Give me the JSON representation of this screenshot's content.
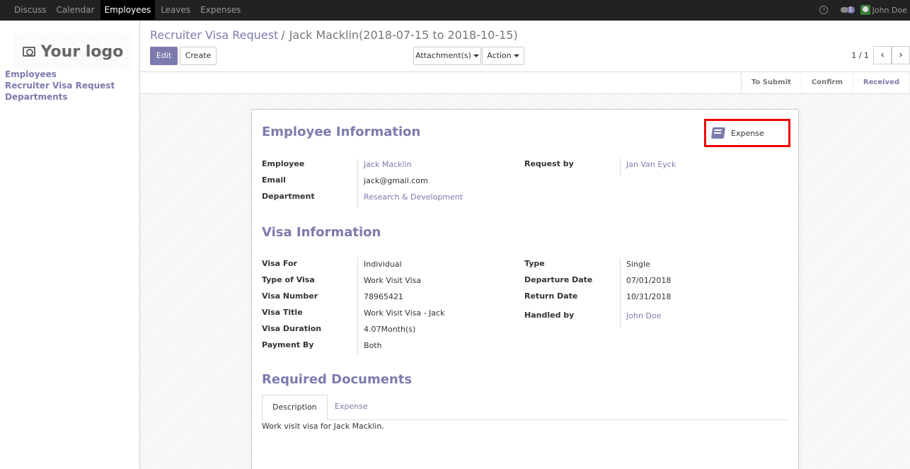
{
  "topbar": {
    "menu": [
      "Discuss",
      "Calendar",
      "Employees",
      "Leaves",
      "Expenses"
    ],
    "active_index": 2,
    "chat_count": "1",
    "user_name": "John Doe"
  },
  "sidebar": {
    "logo_text": "Your logo",
    "links": [
      "Employees",
      "Recruiter Visa Request",
      "Departments"
    ]
  },
  "control": {
    "breadcrumb_parent": "Recruiter Visa Request",
    "breadcrumb_sep": "/",
    "breadcrumb_current": "Jack Macklin(2018-07-15 to 2018-10-15)",
    "edit_label": "Edit",
    "create_label": "Create",
    "attachments_label": "Attachment(s)",
    "action_label": "Action",
    "pager_value": "1 / 1",
    "pager_prev": "‹",
    "pager_next": "›"
  },
  "statusbar": {
    "stages": [
      "To Submit",
      "Confirm",
      "Received"
    ],
    "current_index": 2
  },
  "sheet": {
    "smart_button_label": "Expense",
    "employee_info": {
      "title": "Employee Information",
      "employee_label": "Employee",
      "employee_value": "Jack Macklin",
      "email_label": "Email",
      "email_value": "jack@gmail.com",
      "department_label": "Department",
      "department_value": "Research & Development",
      "request_by_label": "Request by",
      "request_by_value": "Jan Van Eyck"
    },
    "visa_info": {
      "title": "Visa Information",
      "visa_for_label": "Visa For",
      "visa_for_value": "Individual",
      "type_of_visa_label": "Type of Visa",
      "type_of_visa_value": "Work Visit Visa",
      "visa_number_label": "Visa Number",
      "visa_number_value": "78965421",
      "visa_title_label": "Visa Title",
      "visa_title_value": "Work Visit Visa - Jack",
      "visa_duration_label": "Visa Duration",
      "visa_duration_value": "4.07Month(s)",
      "payment_by_label": "Payment By",
      "payment_by_value": "Both",
      "type_label": "Type",
      "type_value": "Single",
      "departure_label": "Departure Date",
      "departure_value": "07/01/2018",
      "return_label": "Return Date",
      "return_value": "10/31/2018",
      "handled_by_label": "Handled by",
      "handled_by_value": "John Doe"
    },
    "required_docs": {
      "title": "Required Documents",
      "tabs": [
        "Description",
        "Expense"
      ],
      "description_text": "Work visit visa for Jack Macklin."
    }
  },
  "colors": {
    "accent": "#7c7bad",
    "topbar_bg": "#222222",
    "highlight_border": "#ee0000"
  }
}
